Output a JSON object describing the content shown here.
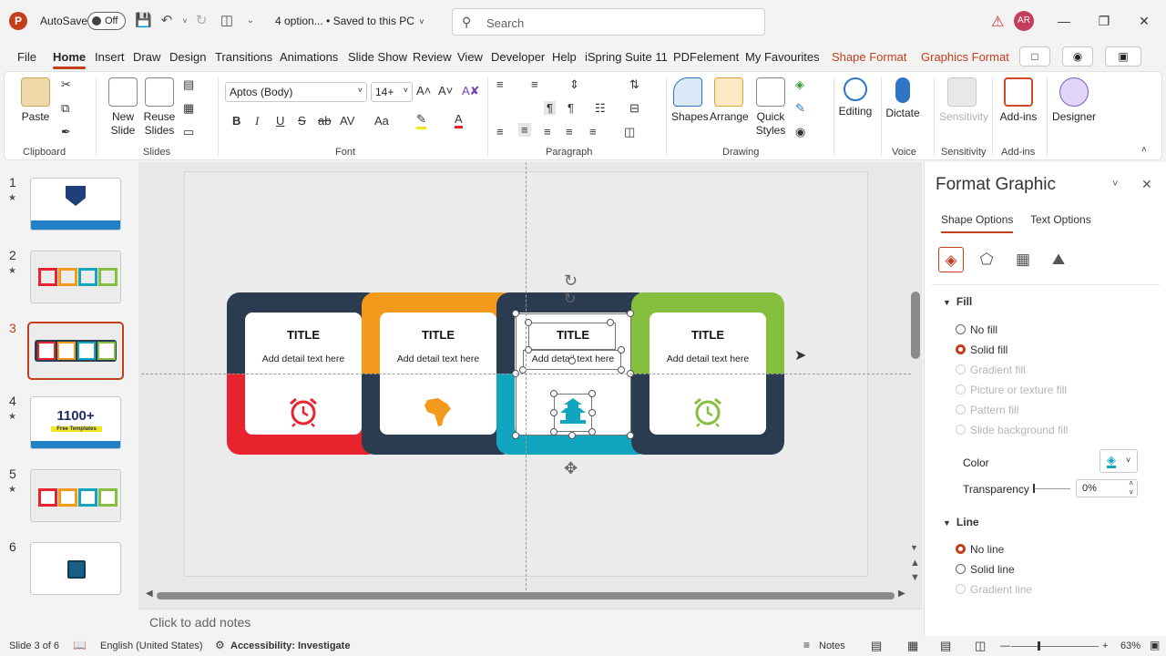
{
  "titlebar": {
    "autosave_label": "AutoSave",
    "autosave_state": "Off",
    "doc_title": "4 option... • Saved to this PC",
    "search_placeholder": "Search",
    "user_initials": "AR"
  },
  "menu": {
    "tabs": [
      "File",
      "Home",
      "Insert",
      "Draw",
      "Design",
      "Transitions",
      "Animations",
      "Slide Show",
      "Review",
      "View",
      "Developer",
      "Help",
      "iSpring Suite 11",
      "PDFelement",
      "My Favourites",
      "Shape Format",
      "Graphics Format"
    ],
    "active": "Home"
  },
  "ribbon": {
    "groups": {
      "clipboard": "Clipboard",
      "slides": "Slides",
      "font": "Font",
      "paragraph": "Paragraph",
      "drawing": "Drawing",
      "voice": "Voice",
      "sensitivity": "Sensitivity",
      "addins": "Add-ins"
    },
    "paste": "Paste",
    "new_slide": "New Slide",
    "reuse_slides": "Reuse Slides",
    "font_name": "Aptos (Body)",
    "font_size": "14+",
    "shapes": "Shapes",
    "arrange": "Arrange",
    "quick_styles": "Quick Styles",
    "editing": "Editing",
    "dictate": "Dictate",
    "sensitivity_btn": "Sensitivity",
    "addins_btn": "Add-ins",
    "designer": "Designer",
    "font_buttons": [
      "B",
      "I",
      "U",
      "S",
      "ab",
      "AV",
      "Aa"
    ]
  },
  "thumbnails": {
    "items": [
      {
        "num": "1",
        "star": "★"
      },
      {
        "num": "2",
        "star": "★"
      },
      {
        "num": "3",
        "star": ""
      },
      {
        "num": "4",
        "star": "★"
      },
      {
        "num": "5",
        "star": "★"
      },
      {
        "num": "6",
        "star": ""
      }
    ],
    "selected": 3,
    "thumb4_text": "1100+",
    "thumb4_sub": "Free Templates"
  },
  "slide": {
    "cards": [
      {
        "title": "TITLE",
        "detail": "Add detail text here",
        "icon": "alarm-clock-icon",
        "icon_color": "#e8232e"
      },
      {
        "title": "TITLE",
        "detail": "Add detail text here",
        "icon": "africa-map-icon",
        "icon_color": "#f39a1d"
      },
      {
        "title": "TITLE",
        "detail": "Add detail text here",
        "icon": "pagoda-icon",
        "icon_color": "#12a5bf"
      },
      {
        "title": "TITLE",
        "detail": "Add detail text here",
        "icon": "alarm-clock-icon",
        "icon_color": "#86bf3d"
      }
    ],
    "colors": {
      "navy": "#2b3c50",
      "red": "#e8232e",
      "orange": "#f39a1d",
      "teal": "#12a5bf",
      "green": "#86bf3d"
    }
  },
  "notes": {
    "placeholder": "Click to add notes"
  },
  "pane": {
    "title": "Format Graphic",
    "tabs": [
      "Shape Options",
      "Text Options"
    ],
    "fill_header": "Fill",
    "fill_options": [
      {
        "label": "No fill",
        "checked": false,
        "disabled": false
      },
      {
        "label": "Solid fill",
        "checked": true,
        "disabled": false
      },
      {
        "label": "Gradient fill",
        "checked": false,
        "disabled": true
      },
      {
        "label": "Picture or texture fill",
        "checked": false,
        "disabled": true
      },
      {
        "label": "Pattern fill",
        "checked": false,
        "disabled": true
      },
      {
        "label": "Slide background fill",
        "checked": false,
        "disabled": true
      }
    ],
    "color_label": "Color",
    "transparency_label": "Transparency",
    "transparency_value": "0%",
    "line_header": "Line",
    "line_options": [
      {
        "label": "No line",
        "checked": true,
        "disabled": false
      },
      {
        "label": "Solid line",
        "checked": false,
        "disabled": false
      },
      {
        "label": "Gradient line",
        "checked": false,
        "disabled": true
      }
    ]
  },
  "status": {
    "slide_info": "Slide 3 of 6",
    "language": "English (United States)",
    "accessibility": "Accessibility: Investigate",
    "notes_btn": "Notes",
    "zoom": "63%"
  }
}
